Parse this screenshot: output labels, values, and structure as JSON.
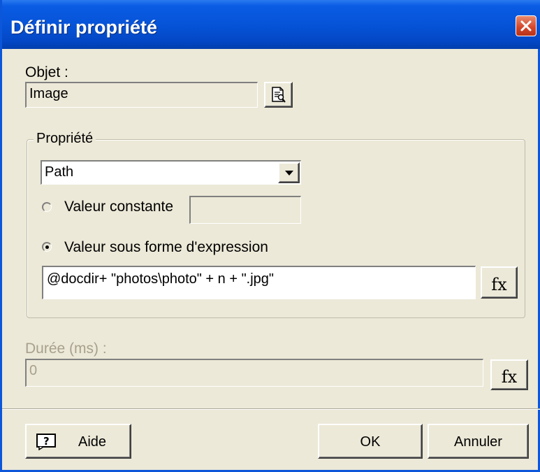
{
  "window": {
    "title": "Définir propriété"
  },
  "objet": {
    "label": "Objet :",
    "value": "Image"
  },
  "propriete": {
    "group_label": "Propriété",
    "dropdown_value": "Path",
    "radio_constant_label": "Valeur constante",
    "radio_constant_value": "",
    "radio_expression_label": "Valeur sous forme d'expression",
    "selected": "expression",
    "expression_value": "@docdir+ \"photos\\photo\" + n + \".jpg\"",
    "fx_label": "fx"
  },
  "duree": {
    "label": "Durée (ms) :",
    "value": "0",
    "fx_label": "fx",
    "enabled": false
  },
  "buttons": {
    "aide": "Aide",
    "ok": "OK",
    "annuler": "Annuler"
  }
}
